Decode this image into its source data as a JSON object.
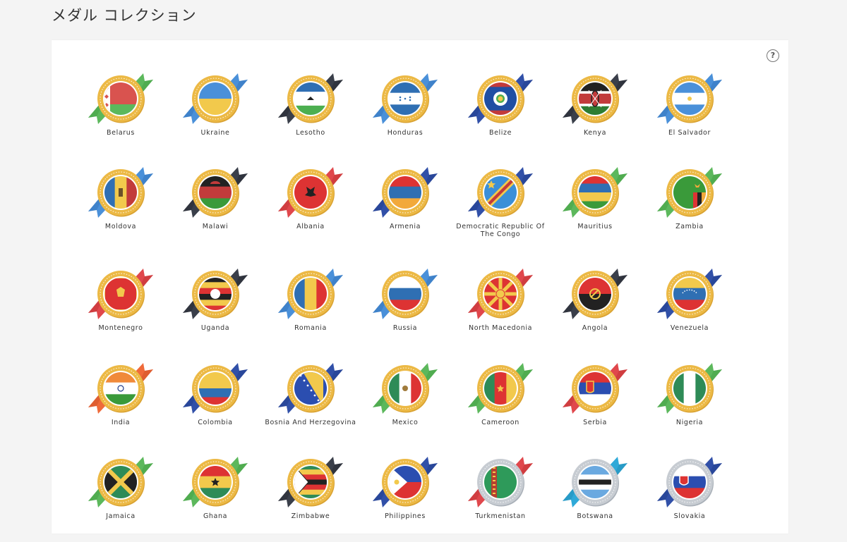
{
  "page_title": "メダル コレクション",
  "help_label": "?",
  "colors": {
    "gold": "#ecb945",
    "silver": "#c7ccd2",
    "panel": "#ffffff",
    "background": "#f4f4f4"
  },
  "medals": [
    {
      "name": "Belarus",
      "ribbon": "green",
      "tier": "gold",
      "flag": "belarus"
    },
    {
      "name": "Ukraine",
      "ribbon": "blue",
      "tier": "gold",
      "flag": "ukraine"
    },
    {
      "name": "Lesotho",
      "ribbon": "dark",
      "tier": "gold",
      "flag": "lesotho"
    },
    {
      "name": "Honduras",
      "ribbon": "blue",
      "tier": "gold",
      "flag": "honduras"
    },
    {
      "name": "Belize",
      "ribbon": "navy",
      "tier": "gold",
      "flag": "belize"
    },
    {
      "name": "Kenya",
      "ribbon": "dark",
      "tier": "gold",
      "flag": "kenya"
    },
    {
      "name": "El Salvador",
      "ribbon": "blue",
      "tier": "gold",
      "flag": "elsalvador"
    },
    {
      "name": "Moldova",
      "ribbon": "blue",
      "tier": "gold",
      "flag": "moldova"
    },
    {
      "name": "Malawi",
      "ribbon": "dark",
      "tier": "gold",
      "flag": "malawi"
    },
    {
      "name": "Albania",
      "ribbon": "red",
      "tier": "gold",
      "flag": "albania"
    },
    {
      "name": "Armenia",
      "ribbon": "navy",
      "tier": "gold",
      "flag": "armenia"
    },
    {
      "name": "Democratic Republic Of The Congo",
      "ribbon": "navy",
      "tier": "gold",
      "flag": "drc"
    },
    {
      "name": "Mauritius",
      "ribbon": "green",
      "tier": "gold",
      "flag": "mauritius"
    },
    {
      "name": "Zambia",
      "ribbon": "green",
      "tier": "gold",
      "flag": "zambia"
    },
    {
      "name": "Montenegro",
      "ribbon": "red",
      "tier": "gold",
      "flag": "montenegro"
    },
    {
      "name": "Uganda",
      "ribbon": "dark",
      "tier": "gold",
      "flag": "uganda"
    },
    {
      "name": "Romania",
      "ribbon": "blue",
      "tier": "gold",
      "flag": "romania"
    },
    {
      "name": "Russia",
      "ribbon": "blue",
      "tier": "gold",
      "flag": "russia"
    },
    {
      "name": "North Macedonia",
      "ribbon": "red",
      "tier": "gold",
      "flag": "macedonia"
    },
    {
      "name": "Angola",
      "ribbon": "dark",
      "tier": "gold",
      "flag": "angola"
    },
    {
      "name": "Venezuela",
      "ribbon": "navy",
      "tier": "gold",
      "flag": "venezuela"
    },
    {
      "name": "India",
      "ribbon": "orange",
      "tier": "gold",
      "flag": "india"
    },
    {
      "name": "Colombia",
      "ribbon": "navy",
      "tier": "gold",
      "flag": "colombia"
    },
    {
      "name": "Bosnia And Herzegovina",
      "ribbon": "navy",
      "tier": "gold",
      "flag": "bosnia"
    },
    {
      "name": "Mexico",
      "ribbon": "green",
      "tier": "gold",
      "flag": "mexico"
    },
    {
      "name": "Cameroon",
      "ribbon": "green",
      "tier": "gold",
      "flag": "cameroon"
    },
    {
      "name": "Serbia",
      "ribbon": "red",
      "tier": "gold",
      "flag": "serbia"
    },
    {
      "name": "Nigeria",
      "ribbon": "green",
      "tier": "gold",
      "flag": "nigeria"
    },
    {
      "name": "Jamaica",
      "ribbon": "green",
      "tier": "gold",
      "flag": "jamaica"
    },
    {
      "name": "Ghana",
      "ribbon": "green",
      "tier": "gold",
      "flag": "ghana"
    },
    {
      "name": "Zimbabwe",
      "ribbon": "dark",
      "tier": "gold",
      "flag": "zimbabwe"
    },
    {
      "name": "Philippines",
      "ribbon": "navy",
      "tier": "gold",
      "flag": "philippines"
    },
    {
      "name": "Turkmenistan",
      "ribbon": "red",
      "tier": "silver",
      "flag": "turkmenistan"
    },
    {
      "name": "Botswana",
      "ribbon": "cyan",
      "tier": "silver",
      "flag": "botswana"
    },
    {
      "name": "Slovakia",
      "ribbon": "navy",
      "tier": "silver",
      "flag": "slovakia"
    }
  ]
}
